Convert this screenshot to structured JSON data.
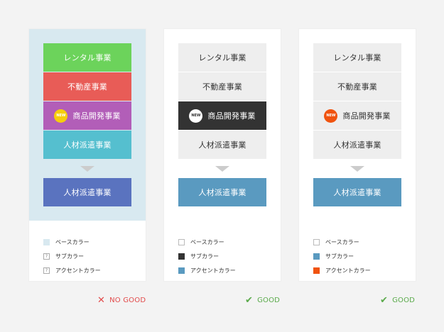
{
  "cards": [
    {
      "items": [
        "レンタル事業",
        "不動産事業",
        "商品開発事業",
        "人材派遣事業"
      ],
      "new_badge": "NEW",
      "result": "人材派遣事業",
      "colors": {
        "base": "#d8e9f0",
        "item1": "#6cd35b",
        "item2": "#e85c57",
        "item3": "#b25eb8",
        "item4": "#55bfcf",
        "result": "#5a73bf",
        "badge": "#f6cd0c"
      },
      "legend": [
        {
          "swatch": "",
          "label": "ベースカラー"
        },
        {
          "swatch": "?",
          "label": "サブカラー"
        },
        {
          "swatch": "?",
          "label": "アクセントカラー"
        }
      ],
      "verdict": {
        "icon": "✕",
        "text": "NO GOOD",
        "color": "#e24b4b"
      }
    },
    {
      "items": [
        "レンタル事業",
        "不動産事業",
        "商品開発事業",
        "人材派遣事業"
      ],
      "new_badge": "NEW",
      "result": "人材派遣事業",
      "colors": {
        "item": "#eeeeee",
        "selected": "#333333",
        "accent": "#5a9ac0",
        "badge": "#ffffff"
      },
      "legend": [
        {
          "swatch": "",
          "label": "ベースカラー"
        },
        {
          "swatch": "",
          "label": "サブカラー"
        },
        {
          "swatch": "",
          "label": "アクセントカラー"
        }
      ],
      "verdict": {
        "icon": "✔",
        "text": "GOOD",
        "color": "#5aaa4b"
      }
    },
    {
      "items": [
        "レンタル事業",
        "不動産事業",
        "商品開発事業",
        "人材派遣事業"
      ],
      "new_badge": "NEW",
      "result": "人材派遣事業",
      "colors": {
        "item": "#eeeeee",
        "accent": "#5a9ac0",
        "badge": "#f0530f"
      },
      "legend": [
        {
          "swatch": "",
          "label": "ベースカラー"
        },
        {
          "swatch": "",
          "label": "サブカラー"
        },
        {
          "swatch": "",
          "label": "アクセントカラー"
        }
      ],
      "verdict": {
        "icon": "✔",
        "text": "GOOD",
        "color": "#5aaa4b"
      }
    }
  ]
}
